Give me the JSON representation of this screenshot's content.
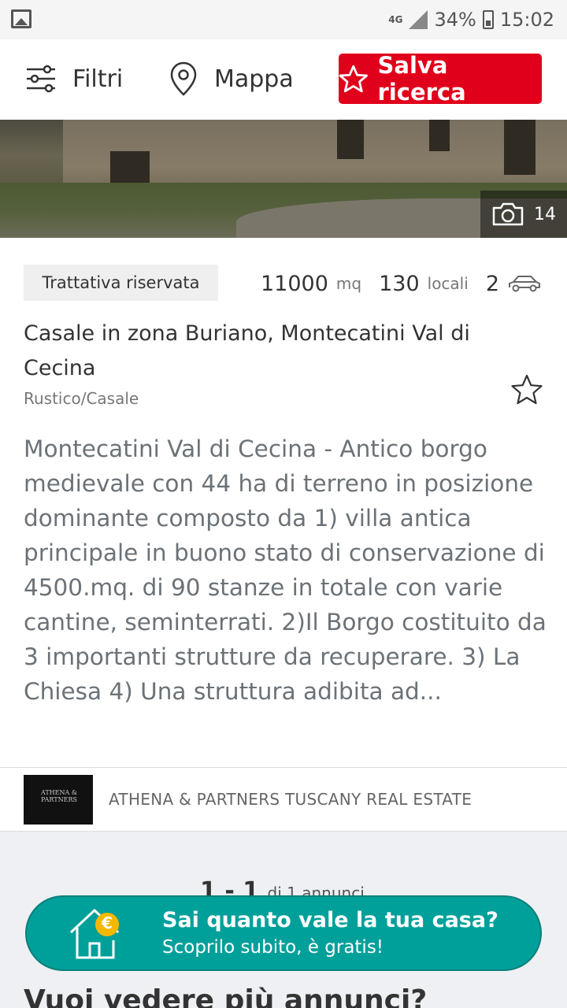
{
  "status_bar": {
    "network": "4G",
    "battery": "34%",
    "time": "15:02"
  },
  "toolbar": {
    "filters_label": "Filtri",
    "map_label": "Mappa",
    "save_search_label": "Salva ricerca"
  },
  "listing": {
    "photo_count": "14",
    "price": "Trattativa riservata",
    "surface_value": "11000",
    "surface_unit": "mq",
    "rooms_value": "130",
    "rooms_unit": "locali",
    "garage_value": "2",
    "title": "Casale in zona Buriano, Montecatini Val di Cecina",
    "category": "Rustico/Casale",
    "description": "Montecatini Val di Cecina - Antico borgo medievale con 44 ha di terreno in posizione dominante composto da 1) villa antica principale in buono stato di conservazione di 4500.mq. di 90 stanze in totale con varie cantine, seminterrati. 2)Il Borgo costituito da 3 importanti strutture da recuperare. 3) La Chiesa 4) Una struttura adibita ad..."
  },
  "agency": {
    "name": "ATHENA & PARTNERS TUSCANY REAL ESTATE",
    "logo_text": "ATHENA & PARTNERS"
  },
  "pagination": {
    "range": "1 - 1",
    "total": "di 1 annunci"
  },
  "banner": {
    "title": "Sai quanto vale la tua casa?",
    "subtitle": "Scoprilo subito, è gratis!",
    "currency_symbol": "€"
  },
  "more_heading": "Vuoi vedere più annunci?",
  "colors": {
    "accent_red": "#e0001b",
    "banner_teal": "#00a09a",
    "coin_yellow": "#f5b800"
  }
}
